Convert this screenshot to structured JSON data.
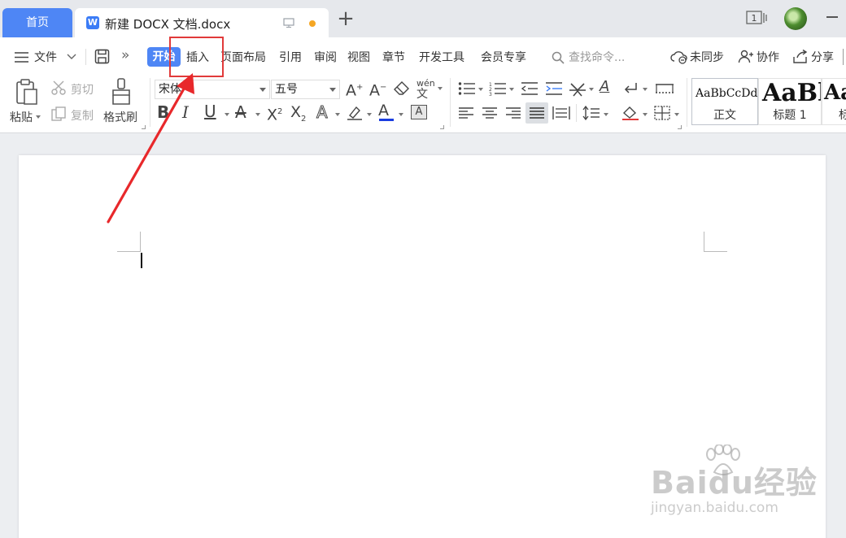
{
  "tabs": {
    "home_label": "首页",
    "doc_title": "新建 DOCX 文档.docx",
    "app_icon_letter": "W",
    "new_tab_symbol": "+",
    "window_count": "1"
  },
  "menu": {
    "file_label": "文件",
    "items": [
      "开始",
      "插入",
      "页面布局",
      "引用",
      "审阅",
      "视图",
      "章节",
      "开发工具",
      "会员专享"
    ],
    "search_placeholder": "查找命令...",
    "sync_label": "未同步",
    "collab_label": "协作",
    "share_label": "分享"
  },
  "ribbon": {
    "paste_label": "粘贴",
    "cut_label": "剪切",
    "copy_label": "复制",
    "format_painter_label": "格式刷",
    "font_name": "宋体",
    "font_size": "五号",
    "pinyin_label": "wén"
  },
  "styles": [
    {
      "sample": "AaBbCcDd",
      "label": "正文"
    },
    {
      "sample": "AaBl",
      "label": "标题 1"
    },
    {
      "sample": "Aa",
      "label": "标"
    }
  ],
  "watermark": {
    "brand": "Baidu经验",
    "url": "jingyan.baidu.com"
  },
  "colors": {
    "accent": "#4e86f5",
    "highlight": "#e13a3a",
    "font_color_bar": "#1a3de0",
    "modified_dot": "#f5a623"
  }
}
